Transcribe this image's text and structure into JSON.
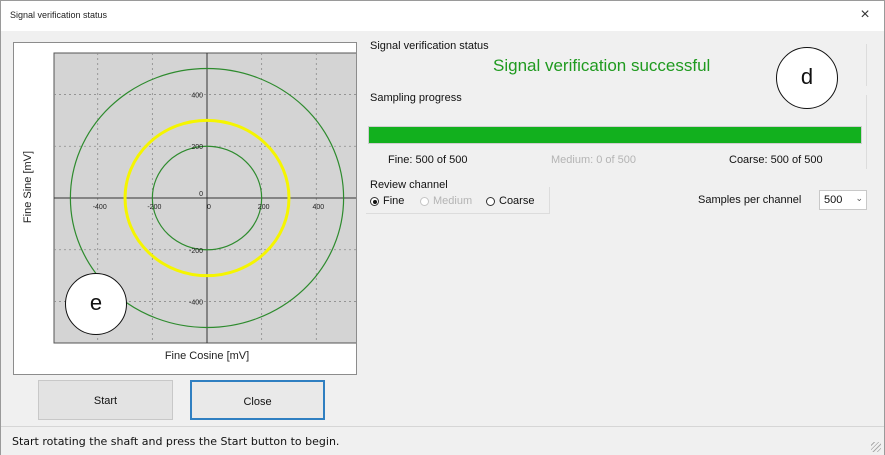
{
  "window": {
    "title": "Signal verification status",
    "close_glyph": "×",
    "close_icon": "close-icon"
  },
  "plot": {
    "xlabel": "Fine Cosine [mV]",
    "ylabel": "Fine Sine [mV]",
    "x_ticks": [
      -400,
      -200,
      0,
      200,
      400
    ],
    "y_ticks": [
      400,
      200,
      0,
      -200,
      -400
    ],
    "circles": [
      {
        "radius": 500,
        "color": "#2e8b2e"
      },
      {
        "radius": 300,
        "color": "#f5f500"
      },
      {
        "radius": 200,
        "color": "#2e8b2e"
      }
    ],
    "range": [
      -560,
      560
    ],
    "grid": true,
    "background": "#d4d4d4"
  },
  "callouts": {
    "e": "e",
    "d": "d"
  },
  "buttons": {
    "start": "Start",
    "close": "Close"
  },
  "status_bar": {
    "text": "Start rotating the shaft and press the Start button to begin."
  },
  "verification": {
    "group_label": "Signal verification status",
    "message": "Signal verification successful",
    "message_color": "#1f9a1f"
  },
  "sampling": {
    "group_label": "Sampling progress",
    "progress_fraction": 1.0,
    "bar_color": "#12b01e",
    "fine": "Fine: 500 of 500",
    "medium": "Medium: 0 of 500",
    "coarse": "Coarse: 500 of 500"
  },
  "review": {
    "group_label": "Review channel",
    "options": [
      {
        "label": "Fine",
        "checked": true,
        "disabled": false
      },
      {
        "label": "Medium",
        "checked": false,
        "disabled": true
      },
      {
        "label": "Coarse",
        "checked": false,
        "disabled": false
      }
    ]
  },
  "samples": {
    "label": "Samples per channel",
    "value": "500",
    "arrow": "⌄"
  }
}
